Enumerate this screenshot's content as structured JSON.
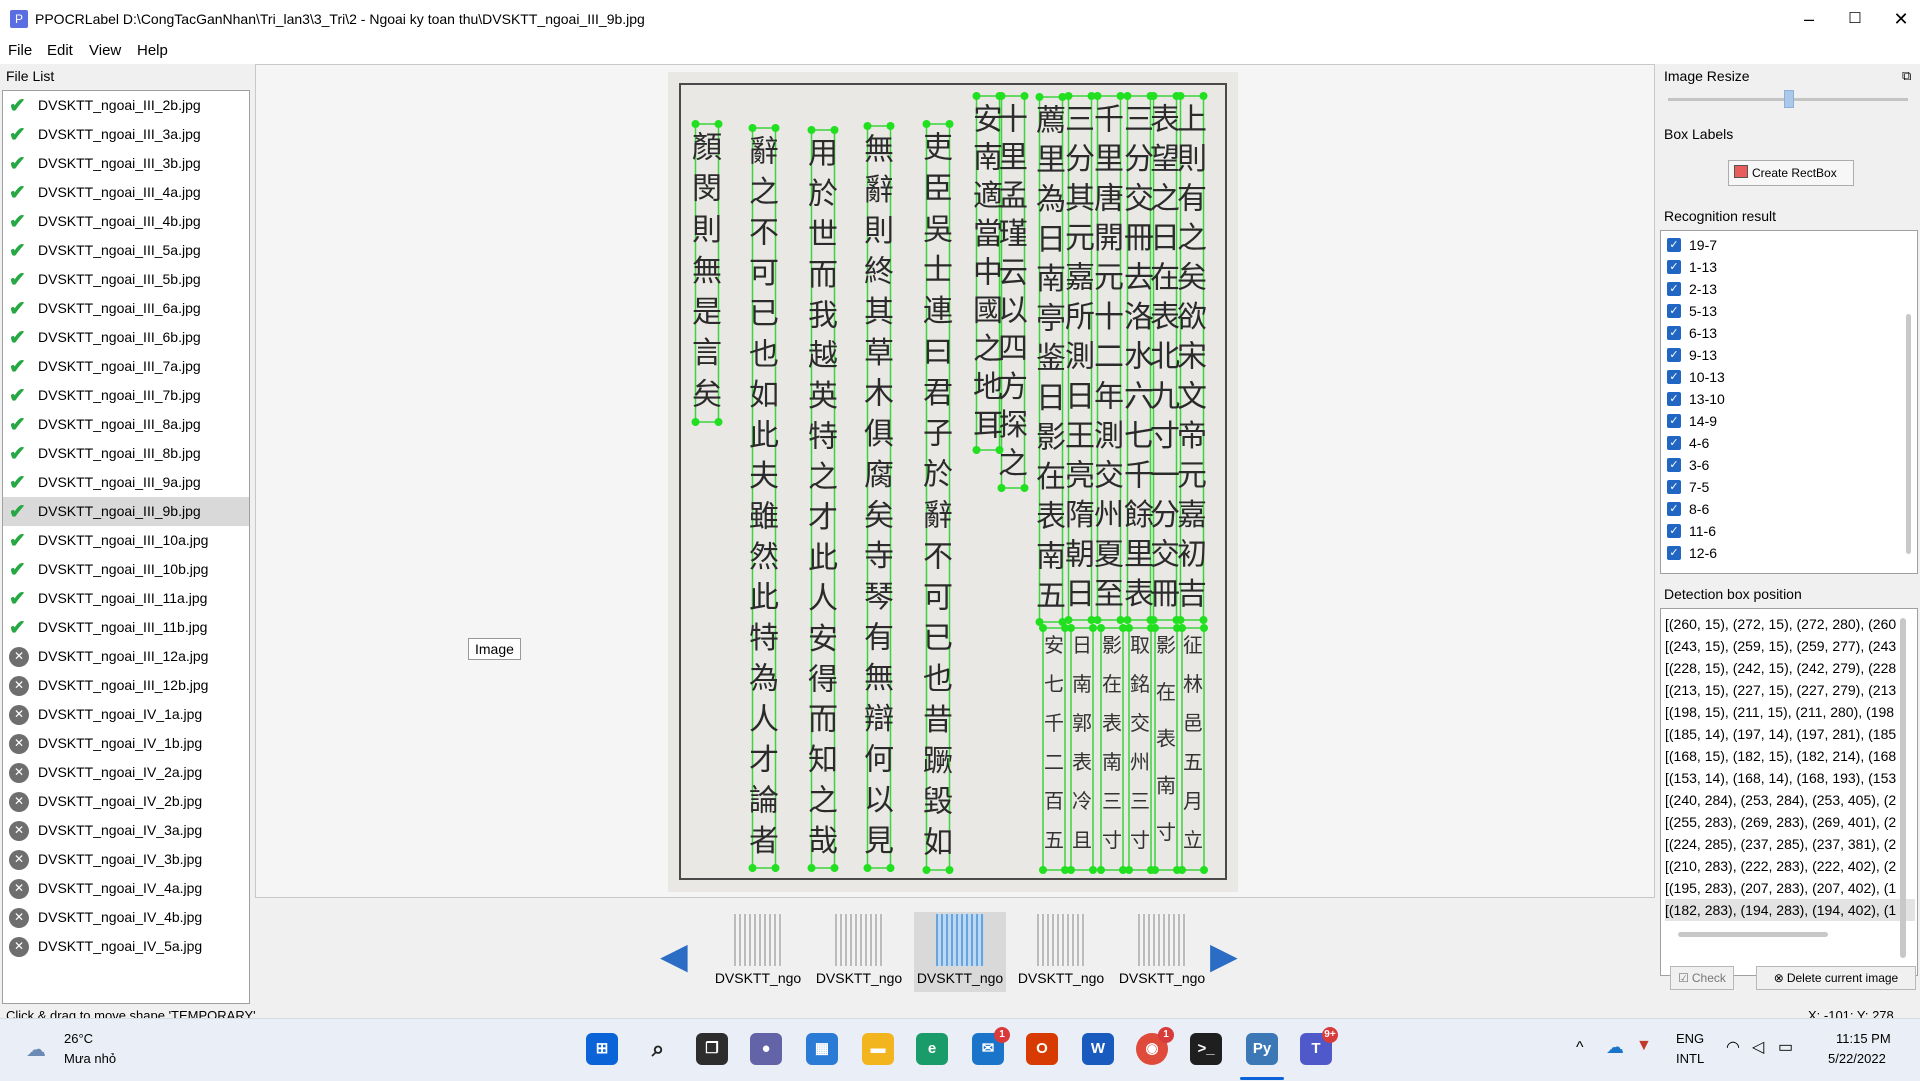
{
  "window": {
    "title": "PPOCRLabel D:\\CongTacGanNhan\\Tri_lan3\\3_Tri\\2 - Ngoai ky toan thu\\DVSKTT_ngoai_III_9b.jpg",
    "app_icon_letter": "P",
    "minimize": "–",
    "maximize": "☐",
    "close": "✕"
  },
  "menu": {
    "file": "File",
    "edit": "Edit",
    "view": "View",
    "help": "Help"
  },
  "file_list": {
    "title": "File List",
    "items": [
      {
        "name": "DVSKTT_ngoai_III_2b.jpg",
        "status": "done"
      },
      {
        "name": "DVSKTT_ngoai_III_3a.jpg",
        "status": "done"
      },
      {
        "name": "DVSKTT_ngoai_III_3b.jpg",
        "status": "done"
      },
      {
        "name": "DVSKTT_ngoai_III_4a.jpg",
        "status": "done"
      },
      {
        "name": "DVSKTT_ngoai_III_4b.jpg",
        "status": "done"
      },
      {
        "name": "DVSKTT_ngoai_III_5a.jpg",
        "status": "done"
      },
      {
        "name": "DVSKTT_ngoai_III_5b.jpg",
        "status": "done"
      },
      {
        "name": "DVSKTT_ngoai_III_6a.jpg",
        "status": "done"
      },
      {
        "name": "DVSKTT_ngoai_III_6b.jpg",
        "status": "done"
      },
      {
        "name": "DVSKTT_ngoai_III_7a.jpg",
        "status": "done"
      },
      {
        "name": "DVSKTT_ngoai_III_7b.jpg",
        "status": "done"
      },
      {
        "name": "DVSKTT_ngoai_III_8a.jpg",
        "status": "done"
      },
      {
        "name": "DVSKTT_ngoai_III_8b.jpg",
        "status": "done"
      },
      {
        "name": "DVSKTT_ngoai_III_9a.jpg",
        "status": "done"
      },
      {
        "name": "DVSKTT_ngoai_III_9b.jpg",
        "status": "done",
        "selected": true
      },
      {
        "name": "DVSKTT_ngoai_III_10a.jpg",
        "status": "done"
      },
      {
        "name": "DVSKTT_ngoai_III_10b.jpg",
        "status": "done"
      },
      {
        "name": "DVSKTT_ngoai_III_11a.jpg",
        "status": "done"
      },
      {
        "name": "DVSKTT_ngoai_III_11b.jpg",
        "status": "done"
      },
      {
        "name": "DVSKTT_ngoai_III_12a.jpg",
        "status": "pending"
      },
      {
        "name": "DVSKTT_ngoai_III_12b.jpg",
        "status": "pending"
      },
      {
        "name": "DVSKTT_ngoai_IV_1a.jpg",
        "status": "pending"
      },
      {
        "name": "DVSKTT_ngoai_IV_1b.jpg",
        "status": "pending"
      },
      {
        "name": "DVSKTT_ngoai_IV_2a.jpg",
        "status": "pending"
      },
      {
        "name": "DVSKTT_ngoai_IV_2b.jpg",
        "status": "pending"
      },
      {
        "name": "DVSKTT_ngoai_IV_3a.jpg",
        "status": "pending"
      },
      {
        "name": "DVSKTT_ngoai_IV_3b.jpg",
        "status": "pending"
      },
      {
        "name": "DVSKTT_ngoai_IV_4a.jpg",
        "status": "pending"
      },
      {
        "name": "DVSKTT_ngoai_IV_4b.jpg",
        "status": "pending"
      },
      {
        "name": "DVSKTT_ngoai_IV_5a.jpg",
        "status": "pending"
      }
    ]
  },
  "canvas": {
    "tooltip": "Image",
    "columns": [
      "上則有之矣欲宋文帝元嘉初吉",
      "表望之日在表北九寸一分交冊",
      "三分交冊去洛水六七千餘里表",
      "千里唐開元十二年測交州夏至",
      "三分其元嘉所測日王亮隋朝日",
      "薦里為日南亭鉴日影在表南五",
      "十里孟瑾云以四方探之",
      "安南適當中國之地耳",
      "吏臣吳士連曰君子於辭不可已也昔蹶毀如",
      "無辭則終其草木俱腐矣寺琴有無辯何以見",
      "用於世而我越英特之才此人安得而知之哉",
      "辭之不可已也如此夫雖然此特為人才論者",
      "顏閔則無是言矣"
    ],
    "lower_columns": [
      "征林邑五月立",
      "影在表南寸",
      "取銘交州三寸",
      "影在表南三寸",
      "日南郭表冷且",
      "安七千二百五"
    ]
  },
  "thumbnails": [
    {
      "label": "DVSKTT_ngo",
      "active": false
    },
    {
      "label": "DVSKTT_ngo",
      "active": false
    },
    {
      "label": "DVSKTT_ngo",
      "active": true
    },
    {
      "label": "DVSKTT_ngo",
      "active": false
    },
    {
      "label": "DVSKTT_ngo",
      "active": false
    }
  ],
  "right_panel": {
    "image_resize_title": "Image Resize",
    "image_resize_level": 0.5,
    "float_icon": "⧉",
    "box_labels_title": "Box Labels",
    "create_rectbox": "Create RectBox",
    "recognition_title": "Recognition result",
    "recognition_items": [
      "19-7",
      "1-13",
      "2-13",
      "5-13",
      "6-13",
      "9-13",
      "10-13",
      "13-10",
      "14-9",
      "4-6",
      "3-6",
      "7-5",
      "8-6",
      "11-6",
      "12-6"
    ],
    "detection_title": "Detection box position",
    "detection_items": [
      "[(260, 15), (272, 15), (272, 280), (260",
      "[(243, 15), (259, 15), (259, 277), (243",
      "[(228, 15), (242, 15), (242, 279), (228",
      "[(213, 15), (227, 15), (227, 279), (213",
      "[(198, 15), (211, 15), (211, 280), (198",
      "[(185, 14), (197, 14), (197, 281), (185",
      "[(168, 15), (182, 15), (182, 214), (168",
      "[(153, 14), (168, 14), (168, 193), (153",
      "[(240, 284), (253, 284), (253, 405), (2",
      "[(255, 283), (269, 283), (269, 401), (2",
      "[(224, 285), (237, 285), (237, 381), (2",
      "[(210, 283), (222, 283), (222, 402), (2",
      "[(195, 283), (207, 283), (207, 402), (1",
      "[(182, 283), (194, 283), (194, 402), (1"
    ],
    "check_label": "Check",
    "delete_label": "Delete current image"
  },
  "status": {
    "message": "Click & drag to move shape 'TEMPORARY'",
    "coords": "X: -101; Y: 278"
  },
  "taskbar": {
    "weather_temp": "26°C",
    "weather_desc": "Mưa nhỏ",
    "lang_top": "ENG",
    "lang_bottom": "INTL",
    "time": "11:15 PM",
    "date": "5/22/2022",
    "mail_badge": "1",
    "chrome_badge": "1",
    "teams_badge": "9+"
  }
}
